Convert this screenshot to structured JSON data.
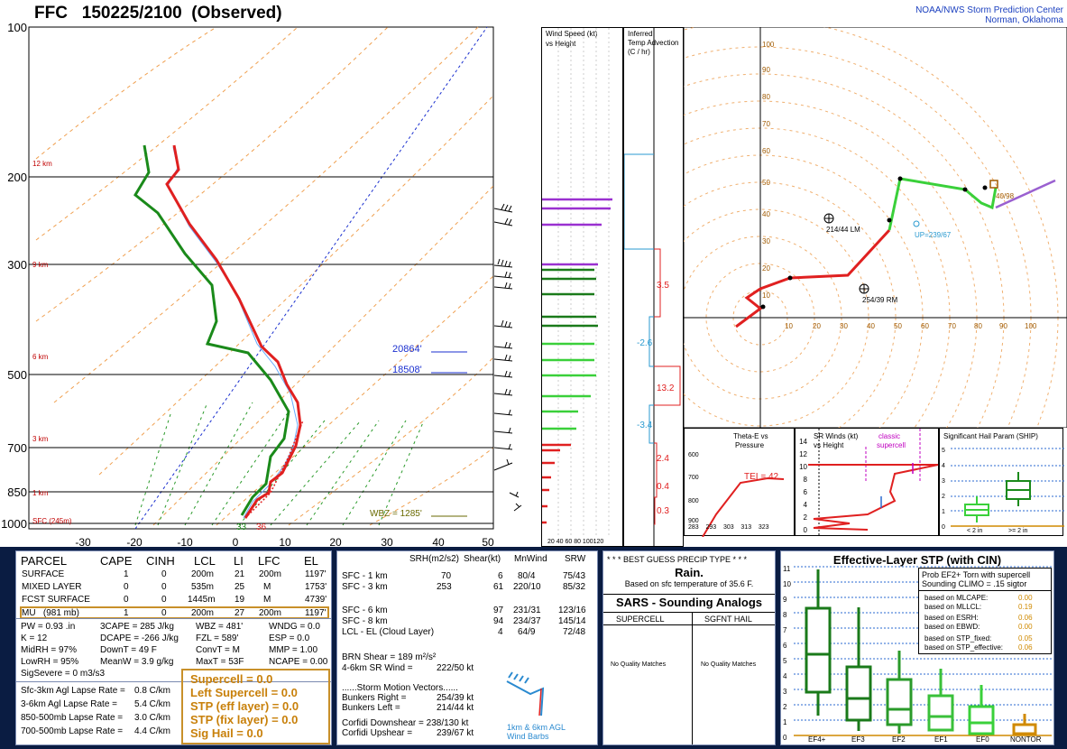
{
  "header": {
    "station": "FFC",
    "datetime": "150225/2100",
    "kind": "(Observed)",
    "org_line1": "NOAA/NWS Storm Prediction Center",
    "org_line2": "Norman, Oklahoma"
  },
  "skewt": {
    "pressure_labels": [
      "100",
      "200",
      "300",
      "500",
      "700",
      "850",
      "1000"
    ],
    "temp_labels": [
      "-30",
      "-20",
      "-10",
      "0",
      "10",
      "20",
      "30",
      "40",
      "50"
    ],
    "height_labels": [
      "12 km",
      "9 km",
      "6 km",
      "3 km",
      "1 km",
      "SFC (245m)"
    ],
    "wbz_label": "WBZ = 1285'",
    "level_label_1": "20864'",
    "level_label_2": "18508'",
    "sfc_temp": "33",
    "sfc_dew": "36"
  },
  "wind_panel": {
    "title1": "Wind Speed (kt)",
    "title2": "vs Height",
    "axis": "20 40 60 80 100120"
  },
  "tadv_panel": {
    "title1": "Inferred",
    "title2": "Temp Advection",
    "title3": "(C / hr)",
    "values": [
      "3.5",
      "-2.6",
      "13.2",
      "-3.4",
      "2.4",
      "0.4",
      "0.3"
    ]
  },
  "hodograph": {
    "labels": [
      "214/44 LM",
      "254/39 RM",
      "UP=239/67",
      "40/98"
    ],
    "ring_labels": [
      "10",
      "20",
      "30",
      "40",
      "50",
      "60",
      "70",
      "80",
      "90",
      "100"
    ]
  },
  "theta_e": {
    "title1": "Theta-E vs",
    "title2": "Pressure",
    "tei": "TEI = 42",
    "p_labels": [
      "600",
      "700",
      "800",
      "900"
    ],
    "x_labels": [
      "283",
      "293",
      "303",
      "313",
      "323"
    ]
  },
  "srwinds": {
    "title1": "SR Winds (kt)",
    "title2": "vs Height",
    "classic1": "classic",
    "classic2": "supercell",
    "h_labels": [
      "14",
      "12",
      "10",
      "8",
      "6",
      "4",
      "2",
      "0"
    ]
  },
  "ship": {
    "title": "Significant Hail Param (SHIP)",
    "lbl_lt": "< 2 in",
    "lbl_ge": ">= 2 in",
    "y_labels": [
      "5",
      "4",
      "3",
      "2",
      "1",
      "0"
    ]
  },
  "parcel_table": {
    "headers": [
      "PARCEL",
      "CAPE",
      "CINH",
      "LCL",
      "LI",
      "LFC",
      "EL"
    ],
    "rows": [
      [
        "SURFACE",
        "1",
        "0",
        "200m",
        "21",
        "200m",
        "1197'"
      ],
      [
        "MIXED LAYER",
        "0",
        "0",
        "535m",
        "25",
        "M",
        "1753'"
      ],
      [
        "FCST SURFACE",
        "0",
        "0",
        "1445m",
        "19",
        "M",
        "4739'"
      ],
      [
        "MU   (981 mb)",
        "1",
        "0",
        "200m",
        "27",
        "200m",
        "1197'"
      ]
    ],
    "stats": [
      [
        "PW = 0.93 .in",
        "3CAPE = 285 J/kg",
        "WBZ = 481'",
        "WNDG = 0.0"
      ],
      [
        "K = 12",
        "DCAPE = -266 J/kg",
        "FZL = 589'",
        "ESP = 0.0"
      ],
      [
        "MidRH = 97%",
        "DownT = 49 F",
        "ConvT = M",
        "MMP = 1.00"
      ],
      [
        "LowRH = 95%",
        "MeanW = 3.9 g/kg",
        "MaxT = 53F",
        "NCAPE = 0.00"
      ]
    ],
    "sigsevere": "SigSevere = 0 m3/s3",
    "lapse": [
      [
        "Sfc-3km Agl Lapse Rate =",
        "0.8 C/km"
      ],
      [
        "3-6km Agl Lapse Rate =",
        "5.4 C/km"
      ],
      [
        "850-500mb Lapse Rate =",
        "3.0 C/km"
      ],
      [
        "700-500mb Lapse Rate =",
        "4.4 C/km"
      ]
    ],
    "composites": [
      "Supercell = 0.0",
      "Left Supercell = 0.0",
      "STP (eff layer) = 0.0",
      "STP (fix layer) = 0.0",
      "Sig Hail = 0.0"
    ]
  },
  "kinematics": {
    "headers": [
      "SRH(m2/s2)",
      "Shear(kt)",
      "MnWind",
      "SRW"
    ],
    "rows": [
      [
        "SFC - 1 km",
        "70",
        "6",
        "80/4",
        "75/43"
      ],
      [
        "SFC - 3 km",
        "253",
        "61",
        "220/10",
        "85/32"
      ],
      [
        "SFC - 6 km",
        "",
        "97",
        "231/31",
        "123/16"
      ],
      [
        "SFC - 8 km",
        "",
        "94",
        "234/37",
        "145/14"
      ],
      [
        "LCL - EL (Cloud Layer)",
        "",
        "4",
        "64/9",
        "72/48"
      ]
    ],
    "brn": "BRN Shear = 189 m²/s²",
    "srwind46": "4-6km SR Wind =",
    "srwind46_val": "222/50 kt",
    "storm_motion": "......Storm Motion Vectors......",
    "bunkers_right": "Bunkers Right =",
    "bunkers_right_val": "254/39 kt",
    "bunkers_left": "Bunkers Left =",
    "bunkers_left_val": "214/44 kt",
    "corfidi_down": "Corfidi Downshear = 238/130 kt",
    "corfidi_up": "Corfidi Upshear =",
    "corfidi_up_val": "239/67 kt",
    "barbs_label1": "1km & 6km AGL",
    "barbs_label2": "Wind Barbs"
  },
  "precip": {
    "title": "* * * BEST GUESS PRECIP TYPE * * *",
    "value": "Rain.",
    "note": "Based on sfc temperature of 35.6 F."
  },
  "sars": {
    "title": "SARS - Sounding Analogs",
    "col1": "SUPERCELL",
    "col2": "SGFNT HAIL",
    "nq1": "No Quality Matches",
    "nq2": "No Quality Matches"
  },
  "stp": {
    "title": "Effective-Layer STP (with CIN)",
    "prob1": "Prob EF2+ Torn with supercell",
    "prob2": "Sounding CLIMO = .15 sigtor",
    "based": [
      [
        "based on MLCAPE:",
        "0.00"
      ],
      [
        "based on MLLCL:",
        "0.19"
      ],
      [
        "based on ESRH:",
        "0.06"
      ],
      [
        "based on EBWD:",
        "0.00"
      ],
      [
        "based on STP_fixed:",
        "0.05"
      ],
      [
        "based on STP_effective:",
        "0.06"
      ]
    ],
    "y_labels": [
      "11",
      "10",
      "9",
      "8",
      "7",
      "6",
      "5",
      "4",
      "3",
      "2",
      "1",
      "0"
    ],
    "categories": [
      "EF4+",
      "EF3",
      "EF2",
      "EF1",
      "EF0",
      "NONTOR"
    ]
  }
}
